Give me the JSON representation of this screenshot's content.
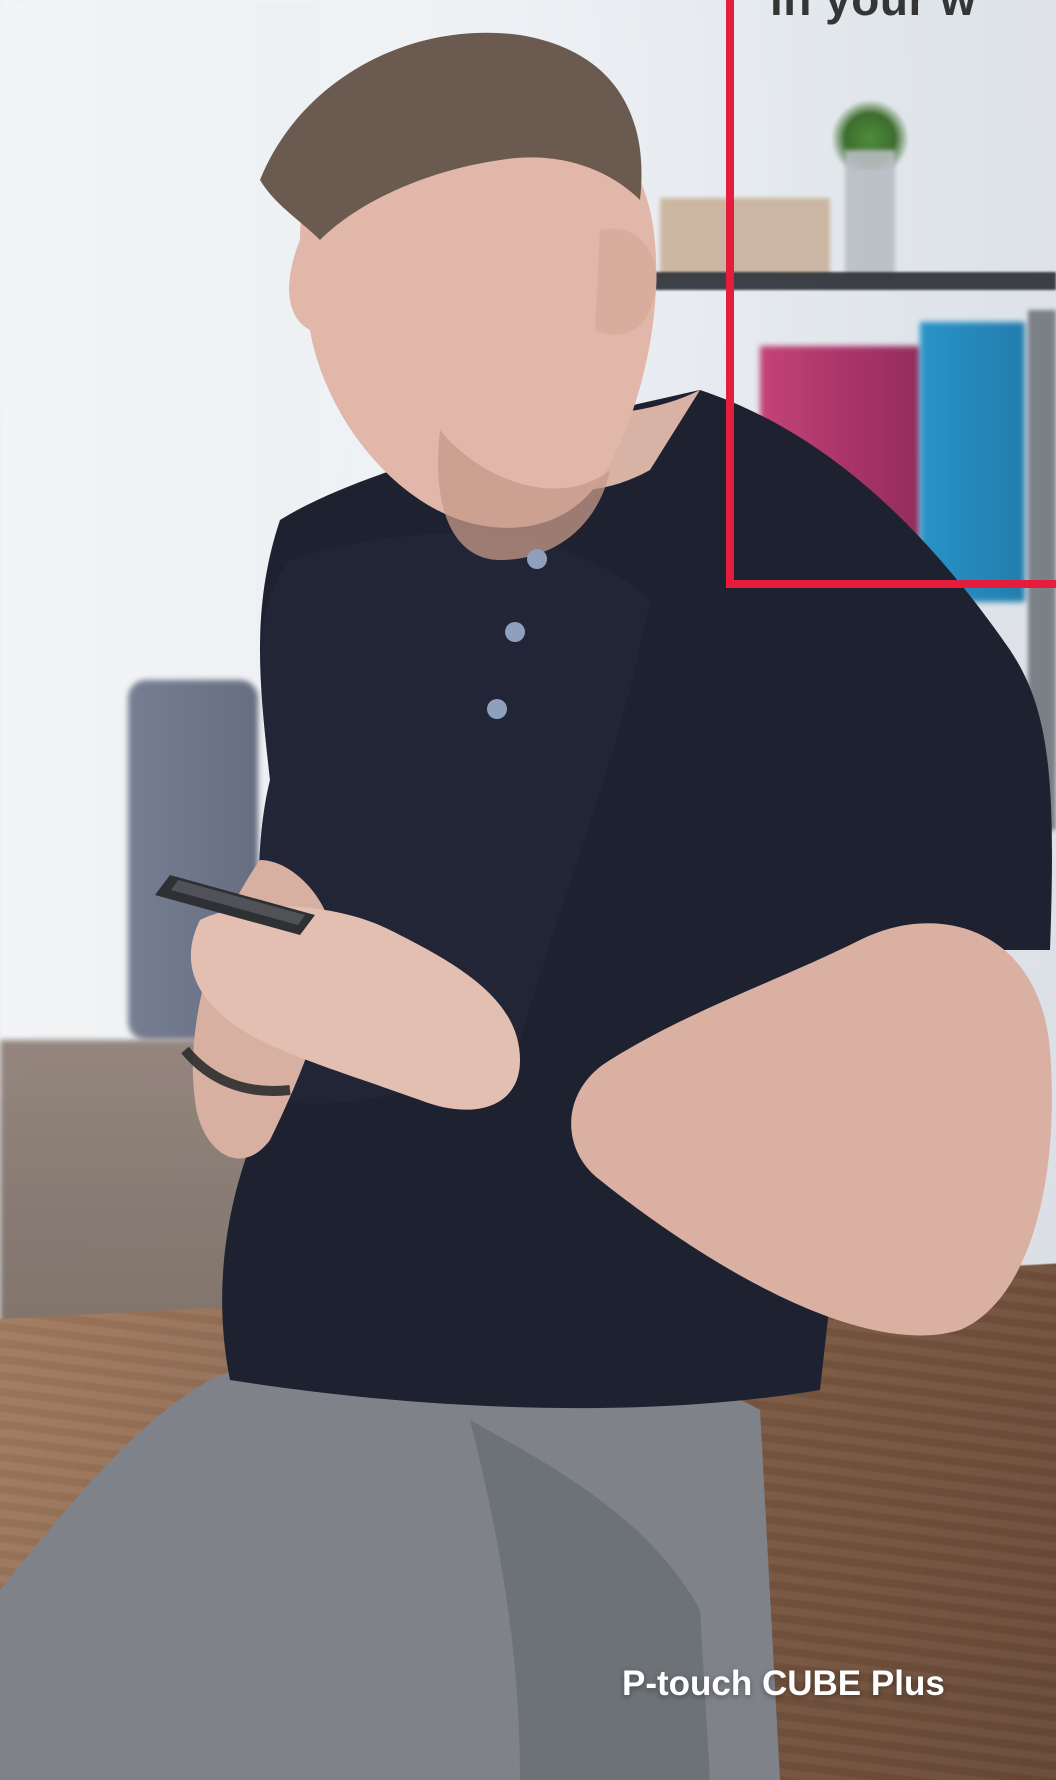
{
  "overlay": {
    "top_caption": "in your w",
    "product_name": "P-touch CUBE Plus",
    "accent_color": "#e51c3b",
    "product_text_color": "#ffffff"
  }
}
